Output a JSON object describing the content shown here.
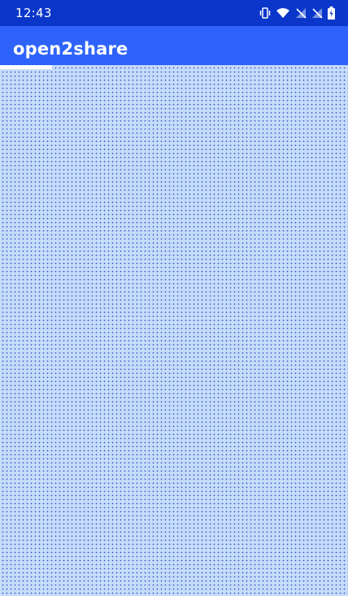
{
  "status_bar": {
    "time": "12:43",
    "icons": [
      "vibrate-icon",
      "wifi-icon",
      "no-signal-icon",
      "no-signal-icon",
      "battery-charging-icon"
    ]
  },
  "app_bar": {
    "title": "open2share"
  },
  "loading": {
    "progress": 0.15
  },
  "colors": {
    "status_bar": "#0a36c9",
    "app_bar": "#2e63fb",
    "content_bg": "#c6dcfb",
    "progress": "#ffffff"
  }
}
